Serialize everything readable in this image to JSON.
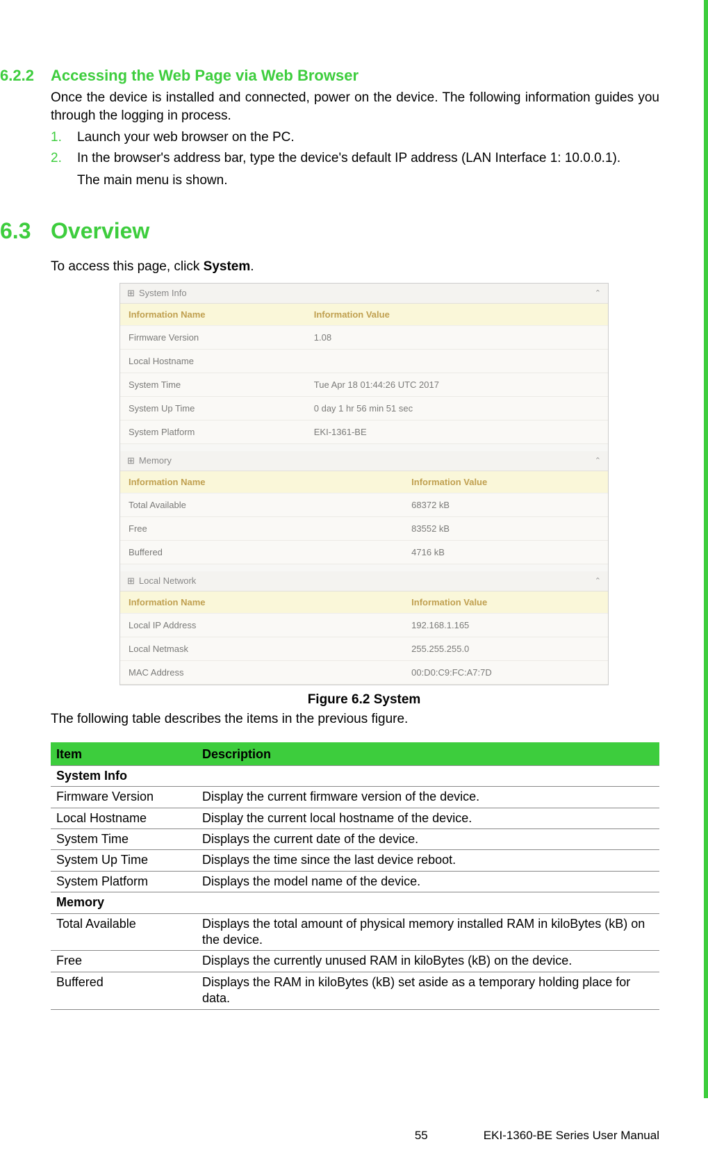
{
  "section_622": {
    "number": "6.2.2",
    "title": "Accessing the Web Page via Web Browser",
    "intro": "Once the device is installed and connected, power on the device. The following information guides you through the logging in process.",
    "steps": [
      {
        "num": "1.",
        "text": "Launch your web browser on the PC."
      },
      {
        "num": "2.",
        "text": "In the browser's address bar, type the device's default IP address (LAN Interface 1: 10.0.0.1)."
      }
    ],
    "step_sub": "The main menu is shown."
  },
  "section_63": {
    "number": "6.3",
    "title": "Overview",
    "intro_prefix": "To access this page, click ",
    "intro_bold": "System",
    "intro_suffix": "."
  },
  "figure": {
    "panels": {
      "system_info": {
        "header": "System Info",
        "col1": "Information Name",
        "col2": "Information Value",
        "rows": [
          {
            "name": "Firmware Version",
            "value": "1.08"
          },
          {
            "name": "Local Hostname",
            "value": ""
          },
          {
            "name": "System Time",
            "value": "Tue Apr 18 01:44:26 UTC 2017"
          },
          {
            "name": "System Up Time",
            "value": "0 day 1 hr 56 min 51 sec"
          },
          {
            "name": "System Platform",
            "value": "EKI-1361-BE"
          }
        ]
      },
      "memory": {
        "header": "Memory",
        "col1": "Information Name",
        "col2": "Information Value",
        "rows": [
          {
            "name": "Total Available",
            "value": "68372 kB"
          },
          {
            "name": "Free",
            "value": "83552 kB"
          },
          {
            "name": "Buffered",
            "value": "4716 kB"
          }
        ]
      },
      "local_network": {
        "header": "Local Network",
        "col1": "Information Name",
        "col2": "Information Value",
        "rows": [
          {
            "name": "Local IP Address",
            "value": "192.168.1.165"
          },
          {
            "name": "Local Netmask",
            "value": "255.255.255.0"
          },
          {
            "name": "MAC Address",
            "value": "00:D0:C9:FC:A7:7D"
          }
        ]
      }
    },
    "caption": "Figure 6.2 System"
  },
  "table_intro": "The following table describes the items in the previous figure.",
  "desc_table": {
    "headers": {
      "item": "Item",
      "description": "Description"
    },
    "rows": [
      {
        "type": "section",
        "item": "System Info",
        "description": ""
      },
      {
        "type": "row",
        "item": "Firmware Version",
        "description": "Display the current firmware version of the device."
      },
      {
        "type": "row",
        "item": "Local Hostname",
        "description": "Display the current local hostname of the device."
      },
      {
        "type": "row",
        "item": "System Time",
        "description": "Displays the current date of the device."
      },
      {
        "type": "row",
        "item": "System Up Time",
        "description": "Displays the time since the last device reboot."
      },
      {
        "type": "row",
        "item": "System Platform",
        "description": "Displays the model name of the device."
      },
      {
        "type": "section",
        "item": "Memory",
        "description": ""
      },
      {
        "type": "row",
        "item": "Total Available",
        "description": "Displays the total amount of physical memory installed RAM in kiloBytes (kB) on the device."
      },
      {
        "type": "row",
        "item": "Free",
        "description": "Displays the currently unused RAM in kiloBytes (kB) on the device."
      },
      {
        "type": "row",
        "item": "Buffered",
        "description": "Displays the RAM in kiloBytes (kB) set aside as a temporary holding place for data."
      }
    ]
  },
  "footer": {
    "page": "55",
    "doc": "EKI-1360-BE Series User Manual"
  }
}
